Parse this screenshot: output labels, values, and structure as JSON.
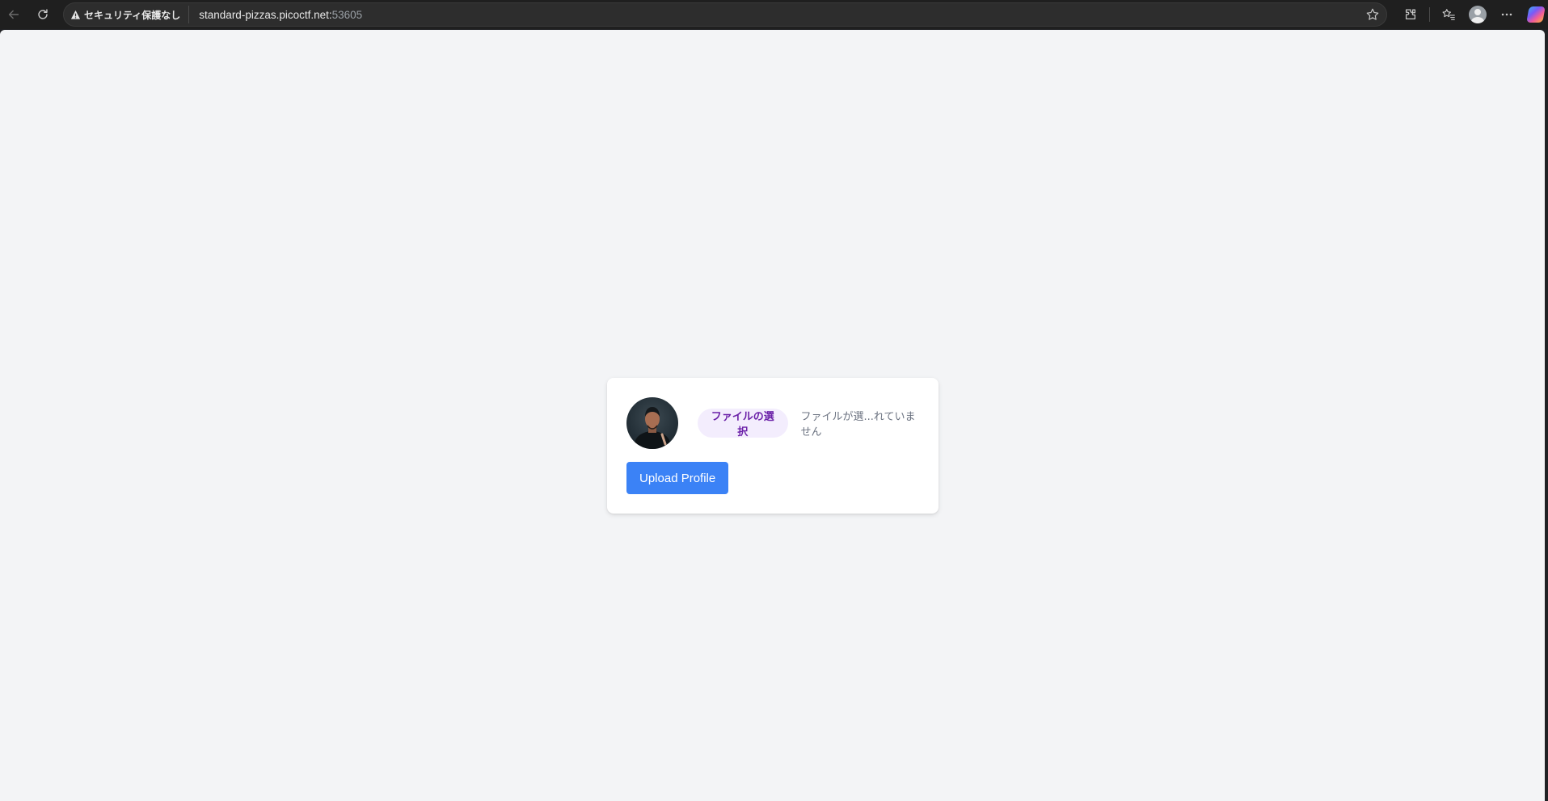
{
  "browser": {
    "security_label": "セキュリティ保護なし",
    "url_host": "standard-pizzas.picoctf.net:",
    "url_port": "53605"
  },
  "page": {
    "file_button_label": "ファイルの選択",
    "file_status": "ファイルが選...れていません",
    "upload_button_label": "Upload Profile"
  },
  "colors": {
    "upload_button": "#3b82f6",
    "file_button_bg": "#f3edfd",
    "file_button_text": "#6b21a8",
    "page_background": "#f3f4f6"
  }
}
